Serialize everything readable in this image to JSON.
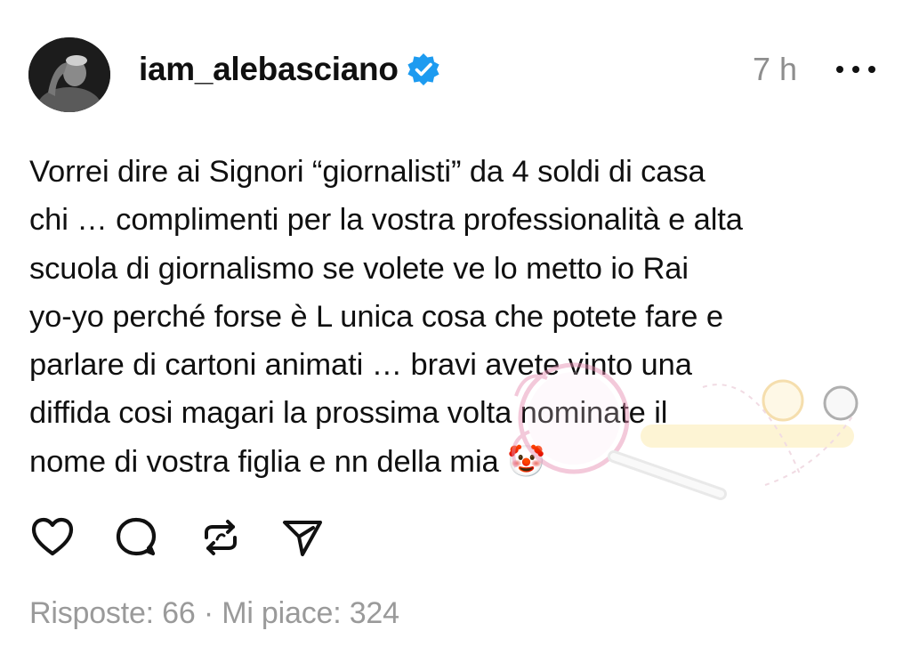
{
  "post": {
    "author": {
      "username": "iam_alebasciano",
      "avatar_icon": "profile-photo",
      "verified_icon": "verified-badge-icon",
      "verified_color": "#1d9bf0"
    },
    "timestamp": "7 h",
    "more_icon": "more-dots-icon",
    "text": "Vorrei dire ai Signori “giornalisti” da 4 soldi di casa\nchi … complimenti per la vostra professionalità e alta\nscuola di giornalismo se volete ve lo metto io Rai\nyo-yo perché forse è L unica cosa che potete fare e\nparlare di cartoni animati … bravi avete vinto una\ndiffida cosi magari la prossima volta nominate il\nnome di vostra figlia e nn della mia 🤡",
    "actions": [
      {
        "name": "like",
        "icon": "heart-icon"
      },
      {
        "name": "reply",
        "icon": "comment-icon"
      },
      {
        "name": "repost",
        "icon": "repost-icon"
      },
      {
        "name": "share",
        "icon": "send-icon"
      }
    ],
    "stats": "Risposte: 66 · Mi piace: 324"
  }
}
